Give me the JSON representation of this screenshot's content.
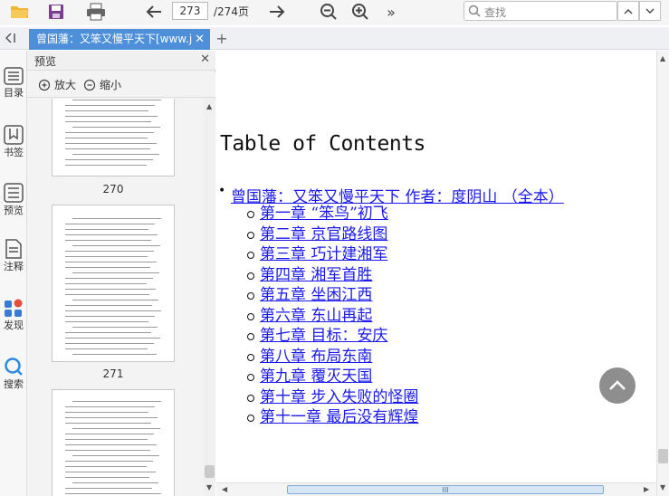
{
  "toolbar": {
    "page_current": "273",
    "page_total": "/274页",
    "search_placeholder": "查找",
    "more_glyph": "»"
  },
  "tabs": {
    "collapse_glyph": "<I",
    "doc_tab_label": "曾国藩：又笨又慢平天下[www.j",
    "close_glyph": "✕",
    "add_glyph": "+"
  },
  "rail": {
    "items": [
      {
        "label": "目录",
        "icon": "list-icon"
      },
      {
        "label": "书签",
        "icon": "bookmark-icon"
      },
      {
        "label": "预览",
        "icon": "preview-icon"
      },
      {
        "label": "注释",
        "icon": "note-icon"
      },
      {
        "label": "发现",
        "icon": "discover-icon"
      },
      {
        "label": "搜索",
        "icon": "search-icon"
      }
    ]
  },
  "preview": {
    "title": "预览",
    "close_glyph": "✕",
    "zoom_in_label": "放大",
    "zoom_out_label": "缩小",
    "page_numbers": [
      "270",
      "271"
    ]
  },
  "content": {
    "toc_title": "Table of Contents",
    "book_title": "曾国藩：又笨又慢平天下 作者：度阴山 （全本）",
    "chapters": [
      "第一章 “笨鸟”初飞",
      "第二章 京官路线图",
      "第三章 巧计建湘军",
      "第四章 湘军首胜",
      "第五章 坐困江西",
      "第六章 东山再起",
      "第七章 目标：安庆",
      "第八章 布局东南",
      "第九章 覆灭天国",
      "第十章 步入失败的怪圈",
      "第十一章 最后没有辉煌"
    ]
  },
  "scroll": {
    "grip_glyph": "III"
  },
  "colors": {
    "tab_active": "#4d8fd9",
    "link": "#1a1aee",
    "fab": "#8e8e8e"
  }
}
